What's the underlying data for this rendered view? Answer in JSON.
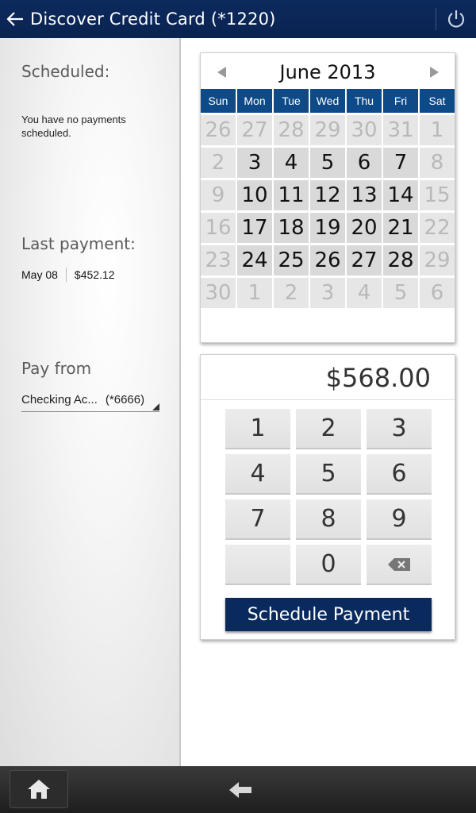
{
  "header": {
    "title": "Discover Credit Card (*1220)",
    "back_icon": "back-arrow-icon",
    "power_icon": "power-icon",
    "background": "#0c2a5e"
  },
  "left": {
    "scheduled_label": "Scheduled:",
    "scheduled_text": "You have no payments scheduled.",
    "last_payment_label": "Last payment:",
    "last_payment_date": "May 08",
    "last_payment_amount": "$452.12",
    "pay_from_label": "Pay from",
    "pay_from_account": "Checking Ac...",
    "pay_from_number": "(*6666)"
  },
  "calendar": {
    "month": "June 2013",
    "weekdays": [
      "Sun",
      "Mon",
      "Tue",
      "Wed",
      "Thu",
      "Fri",
      "Sat"
    ],
    "days": [
      {
        "d": "26",
        "muted": true
      },
      {
        "d": "27",
        "muted": true
      },
      {
        "d": "28",
        "muted": true
      },
      {
        "d": "29",
        "muted": true
      },
      {
        "d": "30",
        "muted": true
      },
      {
        "d": "31",
        "muted": true
      },
      {
        "d": "1",
        "muted": true
      },
      {
        "d": "2",
        "muted": true
      },
      {
        "d": "3",
        "muted": false
      },
      {
        "d": "4",
        "muted": false
      },
      {
        "d": "5",
        "muted": false
      },
      {
        "d": "6",
        "muted": false
      },
      {
        "d": "7",
        "muted": false
      },
      {
        "d": "8",
        "muted": true
      },
      {
        "d": "9",
        "muted": true
      },
      {
        "d": "10",
        "muted": false
      },
      {
        "d": "11",
        "muted": false
      },
      {
        "d": "12",
        "muted": false
      },
      {
        "d": "13",
        "muted": false
      },
      {
        "d": "14",
        "muted": false
      },
      {
        "d": "15",
        "muted": true
      },
      {
        "d": "16",
        "muted": true
      },
      {
        "d": "17",
        "muted": false
      },
      {
        "d": "18",
        "muted": false
      },
      {
        "d": "19",
        "muted": false
      },
      {
        "d": "20",
        "muted": false
      },
      {
        "d": "21",
        "muted": false
      },
      {
        "d": "22",
        "muted": true
      },
      {
        "d": "23",
        "muted": true
      },
      {
        "d": "24",
        "muted": false
      },
      {
        "d": "25",
        "muted": false
      },
      {
        "d": "26",
        "muted": false
      },
      {
        "d": "27",
        "muted": false
      },
      {
        "d": "28",
        "muted": false
      },
      {
        "d": "29",
        "muted": true
      },
      {
        "d": "30",
        "muted": true
      },
      {
        "d": "1",
        "muted": true
      },
      {
        "d": "2",
        "muted": true
      },
      {
        "d": "3",
        "muted": true
      },
      {
        "d": "4",
        "muted": true
      },
      {
        "d": "5",
        "muted": true
      },
      {
        "d": "6",
        "muted": true
      }
    ],
    "weekday_color": "#0e4a88"
  },
  "keypad": {
    "amount": "$568.00",
    "keys": [
      "1",
      "2",
      "3",
      "4",
      "5",
      "6",
      "7",
      "8",
      "9",
      "",
      "0",
      "backspace-icon"
    ],
    "submit_label": "Schedule Payment",
    "submit_color": "#0a2a5e"
  },
  "bottom_nav": {
    "home_icon": "home-icon",
    "back_icon": "back-arrow-icon"
  }
}
